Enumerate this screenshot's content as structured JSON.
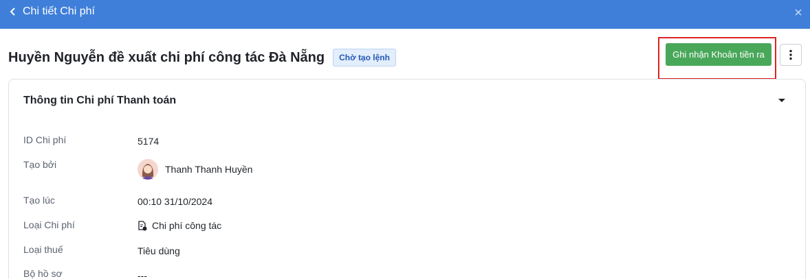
{
  "header": {
    "back_label": "Chi tiết Chi phí",
    "back_icon": "chevron-left-icon",
    "close_icon": "close-icon",
    "color": "#3f7fd9"
  },
  "page": {
    "title": "Huyền Nguyễn đề xuất chi phí công tác Đà Nẵng",
    "status": "Chờ tạo lệnh",
    "primary_action": "Ghi nhận Khoản tiền ra",
    "primary_color": "#49a75a",
    "highlight_color": "#e02020",
    "more_icon": "more-vertical-icon"
  },
  "card": {
    "title": "Thông tin Chi phí Thanh toán",
    "toggle_icon": "caret-down-icon",
    "fields": [
      {
        "label": "ID Chi phí",
        "value": "5174"
      },
      {
        "label": "Tạo bởi",
        "value": "Thanh Thanh Huyền",
        "icon": "avatar"
      },
      {
        "label": "Tạo lúc",
        "value": "00:10 31/10/2024"
      },
      {
        "label": "Loại Chi phí",
        "value": "Chi phí công tác",
        "icon": "document-icon"
      },
      {
        "label": "Loại thuế",
        "value": "Tiêu dùng"
      },
      {
        "label": "Bộ hồ sơ",
        "value": "---"
      }
    ]
  }
}
